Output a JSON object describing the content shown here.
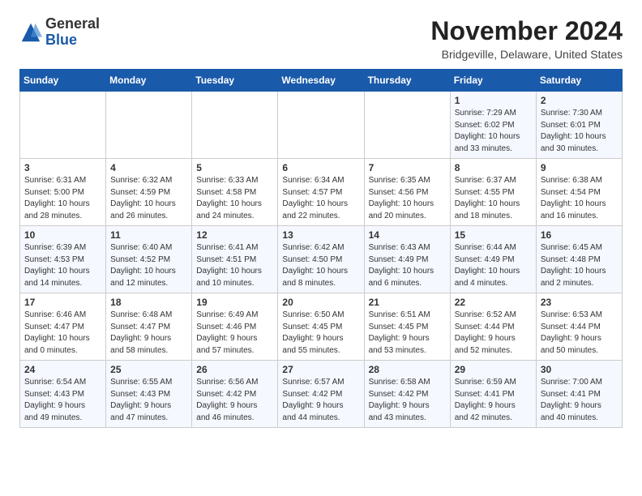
{
  "logo": {
    "general": "General",
    "blue": "Blue"
  },
  "header": {
    "month_year": "November 2024",
    "location": "Bridgeville, Delaware, United States"
  },
  "weekdays": [
    "Sunday",
    "Monday",
    "Tuesday",
    "Wednesday",
    "Thursday",
    "Friday",
    "Saturday"
  ],
  "weeks": [
    [
      {
        "day": "",
        "info": ""
      },
      {
        "day": "",
        "info": ""
      },
      {
        "day": "",
        "info": ""
      },
      {
        "day": "",
        "info": ""
      },
      {
        "day": "",
        "info": ""
      },
      {
        "day": "1",
        "info": "Sunrise: 7:29 AM\nSunset: 6:02 PM\nDaylight: 10 hours\nand 33 minutes."
      },
      {
        "day": "2",
        "info": "Sunrise: 7:30 AM\nSunset: 6:01 PM\nDaylight: 10 hours\nand 30 minutes."
      }
    ],
    [
      {
        "day": "3",
        "info": "Sunrise: 6:31 AM\nSunset: 5:00 PM\nDaylight: 10 hours\nand 28 minutes."
      },
      {
        "day": "4",
        "info": "Sunrise: 6:32 AM\nSunset: 4:59 PM\nDaylight: 10 hours\nand 26 minutes."
      },
      {
        "day": "5",
        "info": "Sunrise: 6:33 AM\nSunset: 4:58 PM\nDaylight: 10 hours\nand 24 minutes."
      },
      {
        "day": "6",
        "info": "Sunrise: 6:34 AM\nSunset: 4:57 PM\nDaylight: 10 hours\nand 22 minutes."
      },
      {
        "day": "7",
        "info": "Sunrise: 6:35 AM\nSunset: 4:56 PM\nDaylight: 10 hours\nand 20 minutes."
      },
      {
        "day": "8",
        "info": "Sunrise: 6:37 AM\nSunset: 4:55 PM\nDaylight: 10 hours\nand 18 minutes."
      },
      {
        "day": "9",
        "info": "Sunrise: 6:38 AM\nSunset: 4:54 PM\nDaylight: 10 hours\nand 16 minutes."
      }
    ],
    [
      {
        "day": "10",
        "info": "Sunrise: 6:39 AM\nSunset: 4:53 PM\nDaylight: 10 hours\nand 14 minutes."
      },
      {
        "day": "11",
        "info": "Sunrise: 6:40 AM\nSunset: 4:52 PM\nDaylight: 10 hours\nand 12 minutes."
      },
      {
        "day": "12",
        "info": "Sunrise: 6:41 AM\nSunset: 4:51 PM\nDaylight: 10 hours\nand 10 minutes."
      },
      {
        "day": "13",
        "info": "Sunrise: 6:42 AM\nSunset: 4:50 PM\nDaylight: 10 hours\nand 8 minutes."
      },
      {
        "day": "14",
        "info": "Sunrise: 6:43 AM\nSunset: 4:49 PM\nDaylight: 10 hours\nand 6 minutes."
      },
      {
        "day": "15",
        "info": "Sunrise: 6:44 AM\nSunset: 4:49 PM\nDaylight: 10 hours\nand 4 minutes."
      },
      {
        "day": "16",
        "info": "Sunrise: 6:45 AM\nSunset: 4:48 PM\nDaylight: 10 hours\nand 2 minutes."
      }
    ],
    [
      {
        "day": "17",
        "info": "Sunrise: 6:46 AM\nSunset: 4:47 PM\nDaylight: 10 hours\nand 0 minutes."
      },
      {
        "day": "18",
        "info": "Sunrise: 6:48 AM\nSunset: 4:47 PM\nDaylight: 9 hours\nand 58 minutes."
      },
      {
        "day": "19",
        "info": "Sunrise: 6:49 AM\nSunset: 4:46 PM\nDaylight: 9 hours\nand 57 minutes."
      },
      {
        "day": "20",
        "info": "Sunrise: 6:50 AM\nSunset: 4:45 PM\nDaylight: 9 hours\nand 55 minutes."
      },
      {
        "day": "21",
        "info": "Sunrise: 6:51 AM\nSunset: 4:45 PM\nDaylight: 9 hours\nand 53 minutes."
      },
      {
        "day": "22",
        "info": "Sunrise: 6:52 AM\nSunset: 4:44 PM\nDaylight: 9 hours\nand 52 minutes."
      },
      {
        "day": "23",
        "info": "Sunrise: 6:53 AM\nSunset: 4:44 PM\nDaylight: 9 hours\nand 50 minutes."
      }
    ],
    [
      {
        "day": "24",
        "info": "Sunrise: 6:54 AM\nSunset: 4:43 PM\nDaylight: 9 hours\nand 49 minutes."
      },
      {
        "day": "25",
        "info": "Sunrise: 6:55 AM\nSunset: 4:43 PM\nDaylight: 9 hours\nand 47 minutes."
      },
      {
        "day": "26",
        "info": "Sunrise: 6:56 AM\nSunset: 4:42 PM\nDaylight: 9 hours\nand 46 minutes."
      },
      {
        "day": "27",
        "info": "Sunrise: 6:57 AM\nSunset: 4:42 PM\nDaylight: 9 hours\nand 44 minutes."
      },
      {
        "day": "28",
        "info": "Sunrise: 6:58 AM\nSunset: 4:42 PM\nDaylight: 9 hours\nand 43 minutes."
      },
      {
        "day": "29",
        "info": "Sunrise: 6:59 AM\nSunset: 4:41 PM\nDaylight: 9 hours\nand 42 minutes."
      },
      {
        "day": "30",
        "info": "Sunrise: 7:00 AM\nSunset: 4:41 PM\nDaylight: 9 hours\nand 40 minutes."
      }
    ]
  ]
}
